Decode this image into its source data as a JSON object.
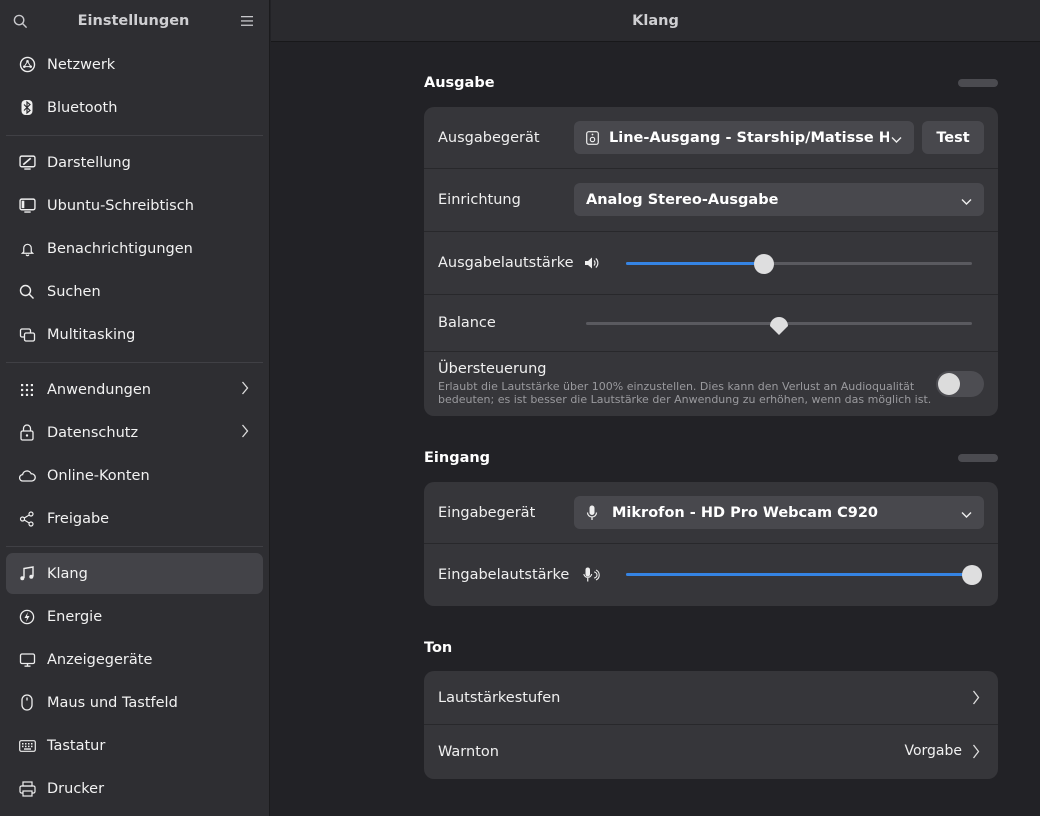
{
  "sidebar": {
    "title": "Einstellungen",
    "groups": [
      [
        {
          "label": "Netzwerk",
          "icon": "network-icon"
        },
        {
          "label": "Bluetooth",
          "icon": "bluetooth-icon"
        }
      ],
      [
        {
          "label": "Darstellung",
          "icon": "appearance-icon"
        },
        {
          "label": "Ubuntu-Schreibtisch",
          "icon": "desktop-icon"
        },
        {
          "label": "Benachrichtigungen",
          "icon": "bell-icon"
        },
        {
          "label": "Suchen",
          "icon": "search-icon"
        },
        {
          "label": "Multitasking",
          "icon": "multitasking-icon"
        }
      ],
      [
        {
          "label": "Anwendungen",
          "icon": "apps-grid-icon"
        },
        {
          "label": "Datenschutz",
          "icon": "lock-icon"
        },
        {
          "label": "Online-Konten",
          "icon": "cloud-icon"
        },
        {
          "label": "Freigabe",
          "icon": "share-icon"
        }
      ],
      [
        {
          "label": "Klang",
          "icon": "music-note-icon"
        },
        {
          "label": "Energie",
          "icon": "power-icon"
        },
        {
          "label": "Anzeigegeräte",
          "icon": "monitor-icon"
        },
        {
          "label": "Maus und Tastfeld",
          "icon": "mouse-icon"
        },
        {
          "label": "Tastatur",
          "icon": "keyboard-icon"
        },
        {
          "label": "Drucker",
          "icon": "printer-icon"
        }
      ]
    ],
    "active": "Klang"
  },
  "main": {
    "title": "Klang",
    "output": {
      "title": "Ausgabe",
      "device_label": "Ausgabegerät",
      "device_value": "Line-Ausgang - Starship/Matisse HD ...",
      "test_label": "Test",
      "setup_label": "Einrichtung",
      "setup_value": "Analog Stereo-Ausgabe",
      "volume_label": "Ausgabelautstärke",
      "volume_fraction": 0.4,
      "balance_label": "Balance",
      "balance_fraction": 0.5,
      "overamp_label": "Übersteuerung",
      "overamp_desc_1": "Erlaubt die Lautstärke über 100% einzustellen. Dies kann den Verlust an Audioqualität",
      "overamp_desc_2": "bedeuten; es ist besser die Lautstärke der Anwendung zu erhöhen, wenn das möglich ist.",
      "overamp_enabled": false
    },
    "input": {
      "title": "Eingang",
      "device_label": "Eingabegerät",
      "device_value": "Mikrofon - HD Pro Webcam C920",
      "volume_label": "Eingabelautstärke",
      "volume_fraction": 1.0
    },
    "tone": {
      "title": "Ton",
      "levels_label": "Lautstärkestufen",
      "alert_label": "Warnton",
      "alert_value": "Vorgabe"
    }
  },
  "colors": {
    "accent": "#3584e4",
    "sidebar_bg": "#2e2e32",
    "card_bg": "#36363a"
  }
}
